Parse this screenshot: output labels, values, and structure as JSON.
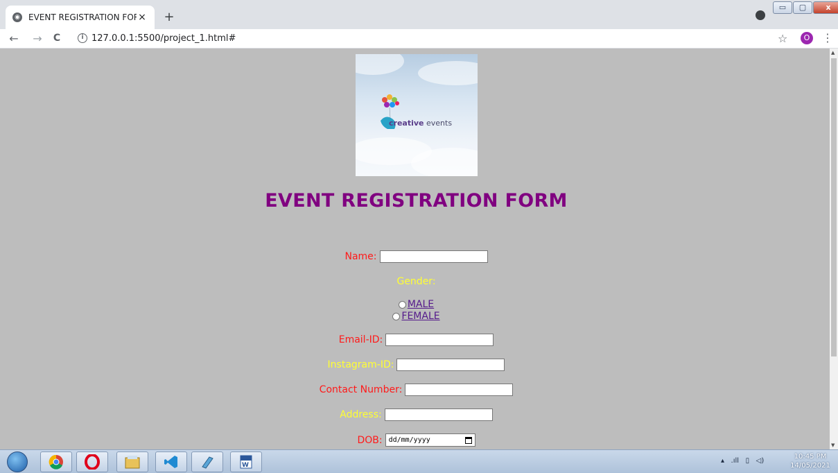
{
  "browser": {
    "tab_title": "EVENT REGISTRATION FORM",
    "tab_close": "×",
    "new_tab": "+",
    "url": "127.0.0.1:5500/project_1.html#",
    "profile_initial": "O",
    "nav": {
      "back": "←",
      "forward": "→",
      "reload": "C",
      "info": "i"
    },
    "star": "☆",
    "menu": "⋮",
    "window_buttons": {
      "minimize": "▭",
      "restore": "▢",
      "close": "x"
    }
  },
  "page": {
    "logo": {
      "brand_bold": "creative",
      "brand_rest": " events"
    },
    "title": "EVENT REGISTRATION FORM",
    "form": {
      "name_label": "Name:",
      "gender_label": "Gender:",
      "gender_options": [
        "MALE",
        "FEMALE"
      ],
      "email_label": "Email-ID:",
      "instagram_label": "Instagram-ID:",
      "contact_label": "Contact Number:",
      "address_label": "Address:",
      "dob_label": "DOB:",
      "dob_placeholder": "dd/mm/yyyy"
    }
  },
  "taskbar": {
    "apps": [
      "chrome-icon",
      "opera-icon",
      "file-explorer-icon",
      "vscode-icon",
      "notepad-icon",
      "word-icon"
    ],
    "clock": {
      "time": "10:45 PM",
      "date": "14/05/2021"
    }
  },
  "colors": {
    "page_bg": "#bdbdbd",
    "title": "#800080",
    "label_red": "#ff1a1a",
    "label_yellow": "#ffff33",
    "link": "#551a8b"
  }
}
